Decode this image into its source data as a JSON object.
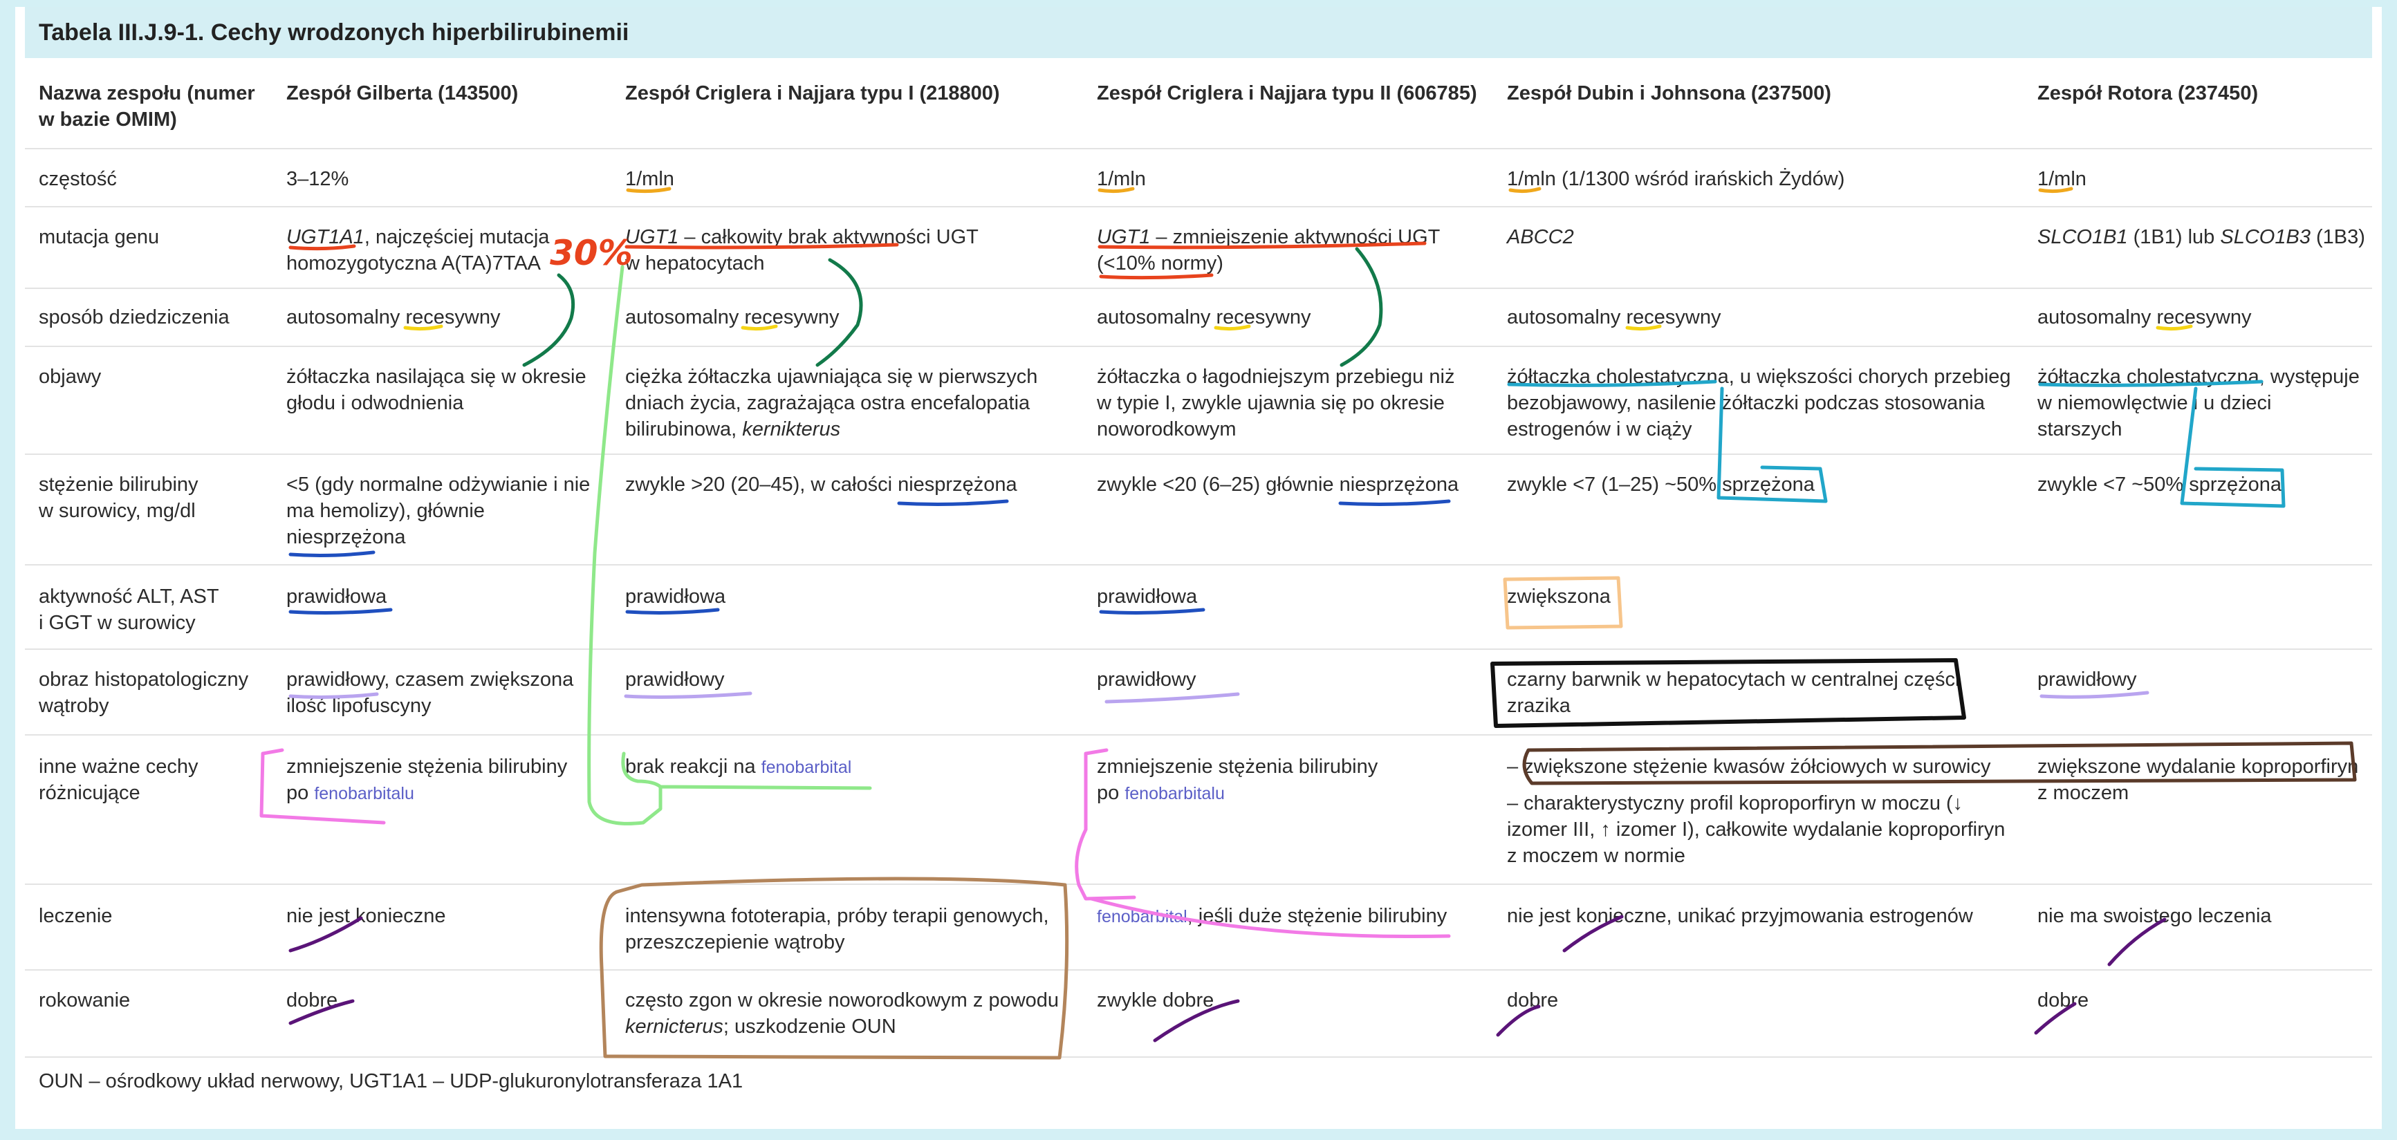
{
  "title": "Tabela III.J.9-1. Cechy wrodzonych hiperbilirubinemii",
  "header": {
    "name_l1": "Nazwa zespołu (numer",
    "name_l2": "w bazie OMIM)",
    "c1": "Zespół Gilberta (143500)",
    "c2": "Zespół Criglera i Najjara typu I (218800)",
    "c3": "Zespół Criglera i Najjara typu II (606785)",
    "c4": "Zespół Dubin i Johnsona (237500)",
    "c5": "Zespół Rotora (237450)"
  },
  "freq": {
    "label": "częstość",
    "c1": "3–12%",
    "c2": "1/mln",
    "c3": "1/mln",
    "c4": "1/mln (1/1300 wśród  irańskich Żydów)",
    "c5": "1/mln"
  },
  "mut": {
    "label": "mutacja genu",
    "c1_gene": "UGT1A1",
    "c1_l1": ", najczęściej mutacja",
    "c1_l2": "homozygotyczna A(TA)7TAA",
    "c2_gene": "UGT1",
    "c2_l1": " – całkowity brak aktywności UGT",
    "c2_l2": "w hepatocytach",
    "c3_gene": "UGT1",
    "c3_l1": " – zmniejszenie aktywności UGT",
    "c3_l2": "(<10% normy)",
    "c4": "ABCC2",
    "c5_g1": "SLCO1B1",
    "c5_m1": " (1B1) lub ",
    "c5_g2": "SLCO1B3",
    "c5_m2": " (1B3)"
  },
  "inh": {
    "label": "sposób dziedziczenia",
    "c1": "autosomalny recesywny",
    "c2": "autosomalny recesywny",
    "c3": "autosomalny recesywny",
    "c4": "autosomalny recesywny",
    "c5": "autosomalny recesywny"
  },
  "sym": {
    "label": "objawy",
    "c1_l1": "żółtaczka nasilająca się w okresie",
    "c1_l2": "głodu i odwodnienia",
    "c2_l1": "ciężka żółtaczka ujawniająca się w pierwszych",
    "c2_l2": "dniach życia, zagrażająca ostra encefalopatia",
    "c2_l3a": "bilirubinowa, ",
    "c2_l3b": "kernikterus",
    "c3_l1": "żółtaczka o łagodniejszym przebiegu niż",
    "c3_l2": "w typie I, zwykle ujawnia się po okresie",
    "c3_l3": "noworodkowym",
    "c4_l1": "żółtaczka cholestatyczna, u większości chorych przebieg",
    "c4_l2": "bezobjawowy, nasilenie żółtaczki podczas stosowania",
    "c4_l3": "estrogenów i w ciąży",
    "c5_l1": "żółtaczka cholestatyczna, występuje",
    "c5_l2": "w niemowlęctwie i u dzieci",
    "c5_l3": "starszych"
  },
  "bil": {
    "label_l1": "stężenie bilirubiny",
    "label_l2": "w surowicy, mg/dl",
    "c1_l1": "<5 (gdy normalne odżywianie i nie",
    "c1_l2": "ma hemolizy), głównie",
    "c1_l3": "niesprzężona",
    "c2": "zwykle >20 (20–45), w całości niesprzężona",
    "c3": "zwykle <20 (6–25) głównie niesprzężona",
    "c4": "zwykle <7 (1–25) ~50% sprzężona",
    "c5": "zwykle <7 ~50% sprzężona"
  },
  "alt": {
    "label_l1": "aktywność ALT, AST",
    "label_l2": "i GGT w surowicy",
    "c1": "prawidłowa",
    "c2": "prawidłowa",
    "c3": "prawidłowa",
    "c4": "zwiększona"
  },
  "hist": {
    "label_l1": "obraz histopatologiczny",
    "label_l2": "wątroby",
    "c1_l1": "prawidłowy, czasem zwiększona",
    "c1_l2": "ilość lipofuscyny",
    "c2": "prawidłowy",
    "c3": "prawidłowy",
    "c4_l1": "czarny barwnik w hepatocytach w centralnej części",
    "c4_l2": "zrazika",
    "c5": "prawidłowy"
  },
  "other": {
    "label_l1": "inne ważne cechy",
    "label_l2": "różnicujące",
    "c1_l1": "zmniejszenie stężenia bilirubiny",
    "c1_l2a": "po ",
    "c1_l2b": "fenobarbitalu",
    "c2a": "brak reakcji na ",
    "c2b": "fenobarbital",
    "c3_l1": "zmniejszenie stężenia bilirubiny",
    "c3_l2a": "po ",
    "c3_l2b": "fenobarbitalu",
    "c4_l1": "– zwiększone stężenie kwasów żółciowych w surowicy",
    "c4_l2": "– charakterystyczny profil koproporfiryn w moczu (↓",
    "c4_l3": "izomer III, ↑ izomer I), całkowite wydalanie koproporfiryn",
    "c4_l4": "z moczem w normie",
    "c5_l1": "zwiększone wydalanie koproporfiryn",
    "c5_l2": "z moczem"
  },
  "treat": {
    "label": "leczenie",
    "c1": "nie jest konieczne",
    "c2_l1": "intensywna fototerapia, próby terapii genowych,",
    "c2_l2": "przeszczepienie wątroby",
    "c3a": "fenobarbital",
    "c3b": ", jeśli duże stężenie bilirubiny",
    "c4": "nie jest konieczne, unikać przyjmowania estrogenów",
    "c5": "nie ma swoistego leczenia"
  },
  "prog": {
    "label": "rokowanie",
    "c1": "dobre",
    "c2_l1": "często zgon w okresie noworodkowym z powodu",
    "c2_l2a": "kernicterus",
    "c2_l2b": "; uszkodzenie OUN",
    "c3": "zwykle dobre",
    "c4": "dobre",
    "c5": "dobre"
  },
  "footnote": "OUN – ośrodkowy układ nerwowy, UGT1A1 – UDP-glukuronylotransferaza 1A1",
  "annotation_text": "30%",
  "colors": {
    "page_bg": "#d4f0f5",
    "title_bg": "#d5eff4",
    "link": "#5b5fc7",
    "red": "#e8431d",
    "orange": "#f0a81c",
    "yellow": "#f5d414",
    "blue": "#1f4fbf",
    "cyan": "#21a6c9",
    "green_dark": "#127a4a",
    "green_light": "#8fe88a",
    "pink": "#f27ae6",
    "purple": "#5a1478",
    "lavender": "#b9a4ef",
    "brown": "#b3855b",
    "dark_brown": "#5b3b2a",
    "peach": "#f7c58b",
    "black": "#111111"
  }
}
